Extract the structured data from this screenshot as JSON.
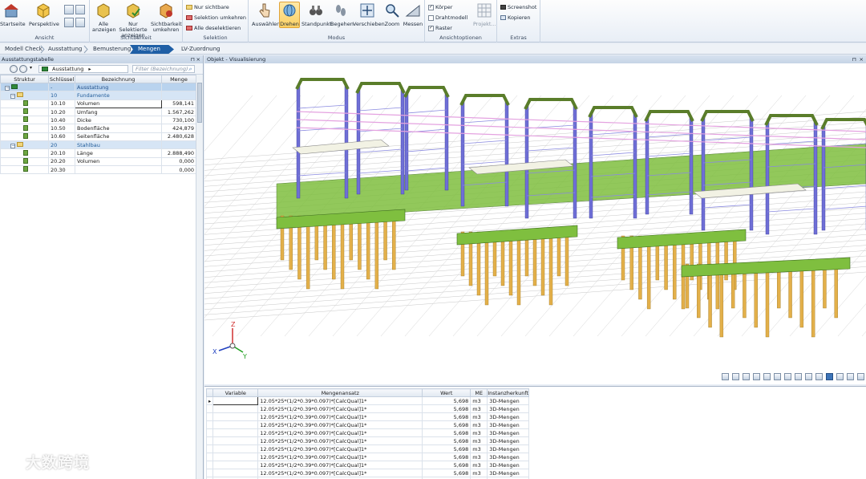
{
  "ribbon": {
    "groups": {
      "ansicht": "Ansicht",
      "sichtbarkeit": "Sichtbarkeit",
      "selektion": "Selektion",
      "modus": "Modus",
      "ansichtoptionen": "Ansichtoptionen",
      "extras": "Extras"
    },
    "startseite": "Startseite",
    "perspektive": "Perspektive",
    "alle_anzeigen": "Alle anzeigen",
    "nur_selektierte": "Nur Selektierte anzeigen",
    "sichtbarkeit_umkehren": "Sichtbarkeit umkehren",
    "nur_sichtbare": "Nur sichtbare",
    "selektion_umkehren": "Selektion umkehren",
    "alle_deselektieren": "Alle deselektieren",
    "modus_buttons": [
      "Auswählen",
      "Drehen",
      "Standpunkt",
      "Begehen",
      "Verschieben",
      "Zoom",
      "Messen"
    ],
    "modus_active": "Drehen",
    "checkboxes": [
      {
        "label": "Körper",
        "checked": true
      },
      {
        "label": "Drahtmodell",
        "checked": false
      },
      {
        "label": "Raster",
        "checked": true
      }
    ],
    "projektion": "Projekt...",
    "screenshot": "Screenshot",
    "kopieren": "Kopieren"
  },
  "workflow_tabs": [
    "Modell Check",
    "Ausstattung",
    "Bemusterung",
    "Mengen",
    "LV-Zuordnung"
  ],
  "workflow_active": "Mengen",
  "left_panel": {
    "title": "Ausstattungstabelle",
    "dropdown": "Ausstattung",
    "filter_placeholder": "Filter (Bezeichnung)",
    "columns": [
      "Struktur",
      "Schlüssel",
      "Bezeichnung",
      "Menge"
    ],
    "rows": [
      {
        "type": "top",
        "key": "-",
        "label": "Ausstattung",
        "value": ""
      },
      {
        "type": "group",
        "key": "10",
        "label": "Fundamente",
        "value": ""
      },
      {
        "type": "item",
        "key": "10.10",
        "label": "Volumen",
        "value": "598,141",
        "selected": true
      },
      {
        "type": "item",
        "key": "10.20",
        "label": "Umfang",
        "value": "1.567,262"
      },
      {
        "type": "item",
        "key": "10.40",
        "label": "Dicke",
        "value": "730,100"
      },
      {
        "type": "item",
        "key": "10.50",
        "label": "Bodenfläche",
        "value": "424,879"
      },
      {
        "type": "item",
        "key": "10.60",
        "label": "Seitenfläche",
        "value": "2.480,628"
      },
      {
        "type": "group",
        "key": "20",
        "label": "Stahlbau",
        "value": ""
      },
      {
        "type": "item",
        "key": "20.10",
        "label": "Länge",
        "value": "2.888,490"
      },
      {
        "type": "item",
        "key": "20.20",
        "label": "Volumen",
        "value": "0,000"
      },
      {
        "type": "item",
        "key": "20.30",
        "label": "",
        "value": "0,000"
      }
    ]
  },
  "viz_panel": {
    "title": "Objekt - Visualisierung",
    "axis": {
      "x": "X",
      "y": "Y",
      "z": "Z"
    }
  },
  "bottom_table": {
    "columns": [
      "Variable",
      "Mengenansatz",
      "Wert",
      "ME",
      "Instanzherkunft"
    ],
    "rows": [
      {
        "var": "",
        "ansatz": "12.05*25*(1/2*0.39*0.097)*[CalcQual]1*",
        "wert": "5,698",
        "me": "m3",
        "herkunft": "3D-Mengen"
      },
      {
        "var": "",
        "ansatz": "12.05*25*(1/2*0.39*0.097)*[CalcQual]1*",
        "wert": "5,698",
        "me": "m3",
        "herkunft": "3D-Mengen"
      },
      {
        "var": "",
        "ansatz": "12.05*25*(1/2*0.39*0.097)*[CalcQual]1*",
        "wert": "5,698",
        "me": "m3",
        "herkunft": "3D-Mengen"
      },
      {
        "var": "",
        "ansatz": "12.05*25*(1/2*0.39*0.097)*[CalcQual]1*",
        "wert": "5,698",
        "me": "m3",
        "herkunft": "3D-Mengen"
      },
      {
        "var": "",
        "ansatz": "12.05*25*(1/2*0.39*0.097)*[CalcQual]1*",
        "wert": "5,698",
        "me": "m3",
        "herkunft": "3D-Mengen"
      },
      {
        "var": "",
        "ansatz": "12.05*25*(1/2*0.39*0.097)*[CalcQual]1*",
        "wert": "5,698",
        "me": "m3",
        "herkunft": "3D-Mengen"
      },
      {
        "var": "",
        "ansatz": "12.05*25*(1/2*0.39*0.097)*[CalcQual]1*",
        "wert": "5,698",
        "me": "m3",
        "herkunft": "3D-Mengen"
      },
      {
        "var": "",
        "ansatz": "12.05*25*(1/2*0.39*0.097)*[CalcQual]1*",
        "wert": "5,698",
        "me": "m3",
        "herkunft": "3D-Mengen"
      },
      {
        "var": "",
        "ansatz": "12.05*25*(1/2*0.39*0.097)*[CalcQual]1*",
        "wert": "5,698",
        "me": "m3",
        "herkunft": "3D-Mengen"
      },
      {
        "var": "",
        "ansatz": "12.05*25*(1/2*0.39*0.097)*[CalcQual]1*",
        "wert": "5,698",
        "me": "m3",
        "herkunft": "3D-Mengen"
      },
      {
        "var": "",
        "ansatz": "12.05*25*(1/2*0.39*0.097)*[CalcQual]1*",
        "wert": "5,698",
        "me": "m3",
        "herkunft": "3D-Mengen"
      }
    ]
  },
  "watermark": "大数跨境",
  "colors": {
    "accent": "#1f5fa6",
    "steel_column": "#6f6fd6",
    "steel_beam": "#5a7d2a",
    "foundation": "#7fbf3f",
    "pile": "#e3b04a"
  }
}
